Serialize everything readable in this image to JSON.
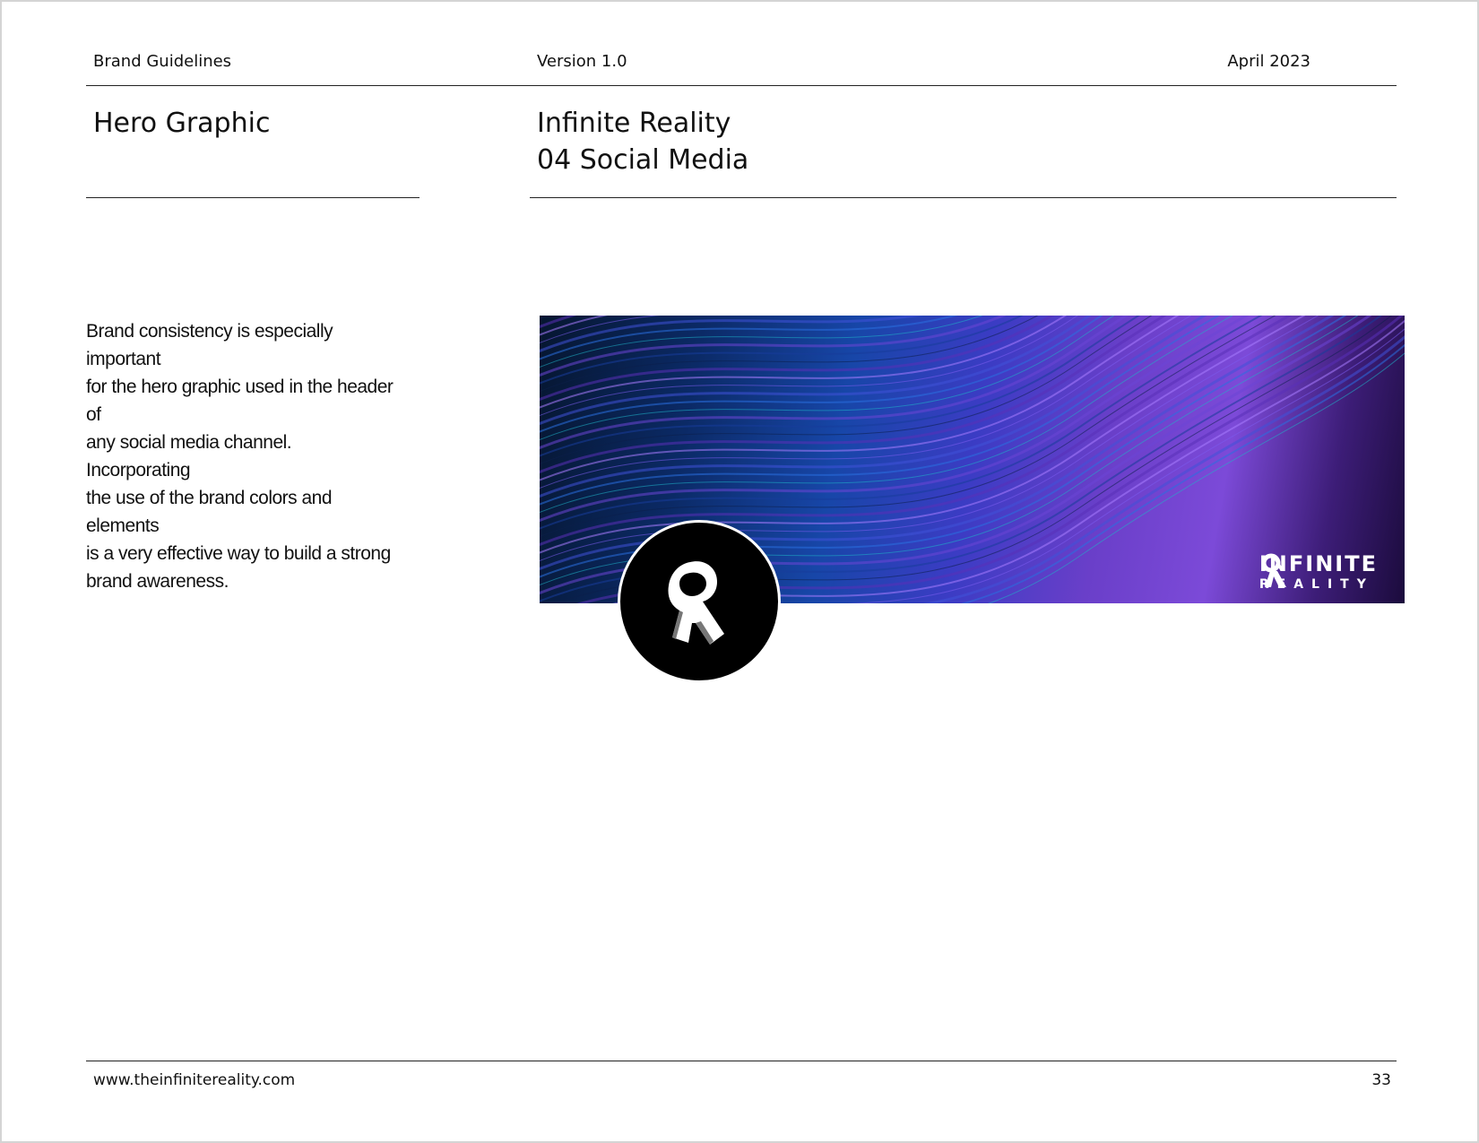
{
  "header": {
    "left": "Brand Guidelines",
    "center": "Version 1.0",
    "right": "April 2023"
  },
  "section": {
    "title": "Hero Graphic",
    "subtitle_line1": "Infinite Reality",
    "subtitle_line2": "04 Social Media"
  },
  "body": {
    "lines": [
      "Brand consistency is especially important",
      "for the hero graphic used in the header of",
      "any social media channel. Incorporating",
      "the use of the brand colors and elements",
      "is a very effective way to build a strong",
      "brand awareness."
    ]
  },
  "banner": {
    "logo_word1": "INFINITE",
    "logo_word2": "REALITY"
  },
  "footer": {
    "url": "www.theinfinitereality.com",
    "page": "33"
  }
}
